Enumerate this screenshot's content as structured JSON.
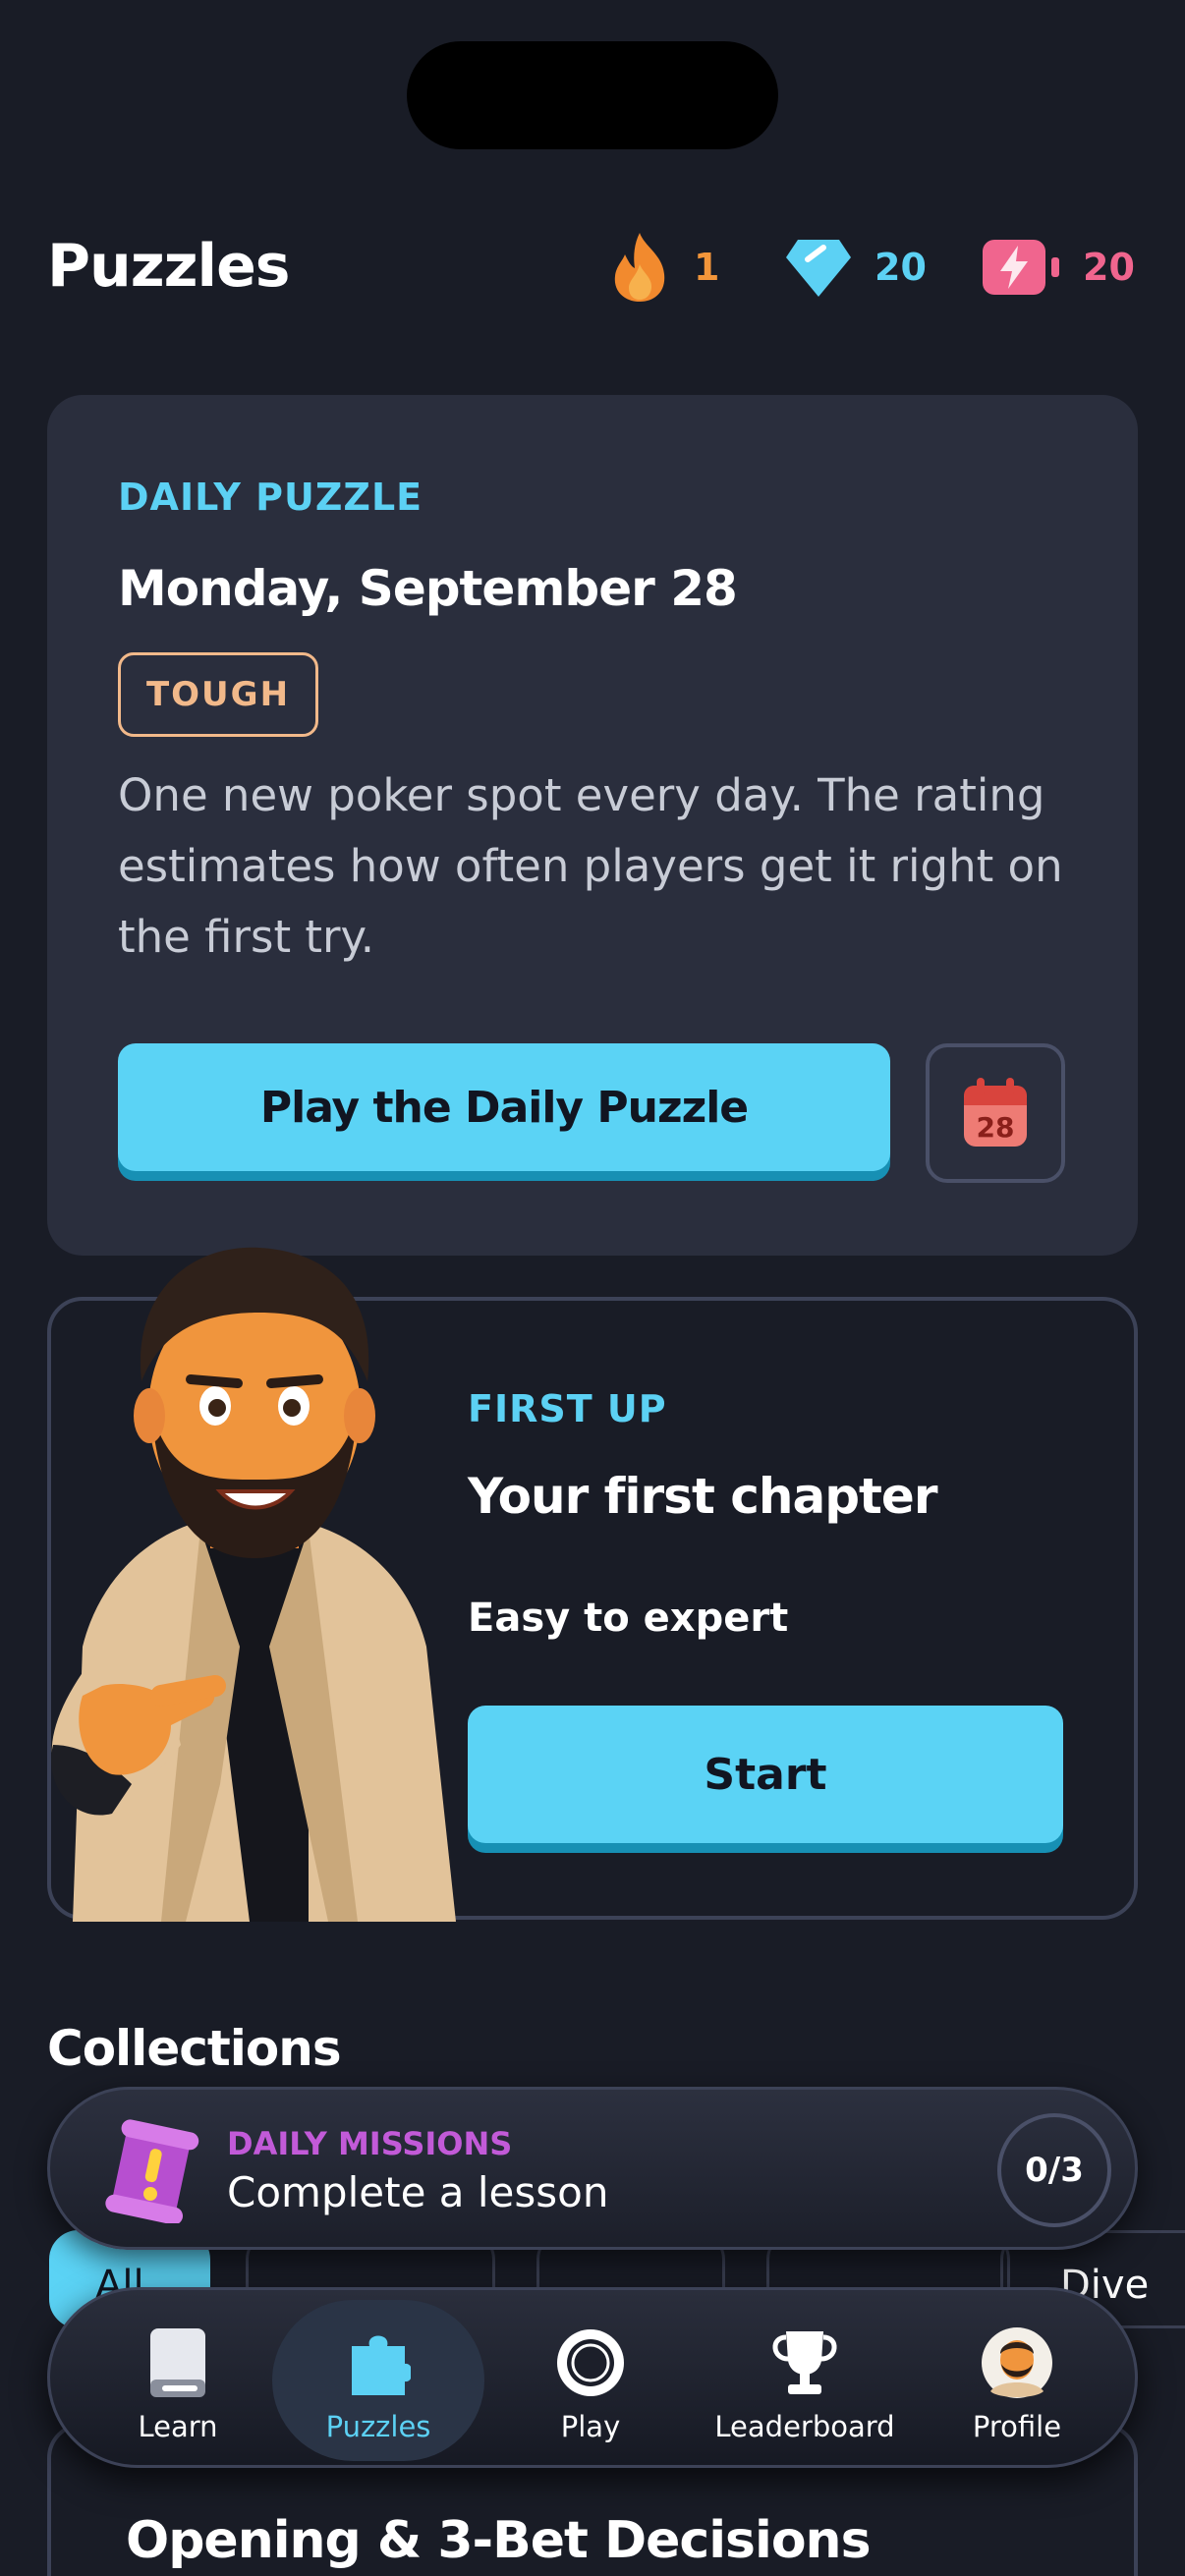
{
  "header": {
    "title": "Puzzles",
    "stats": {
      "streak": "1",
      "gems": "20",
      "energy": "20"
    }
  },
  "daily": {
    "kicker": "DAILY PUZZLE",
    "date": "Monday, September 28",
    "difficulty": "TOUGH",
    "description": "One new poker spot every day. The rating estimates how often players get it right on the first try.",
    "play_label": "Play the Daily Puzzle",
    "calendar_day": "28"
  },
  "first_up": {
    "kicker": "FIRST UP",
    "title": "Your first chapter",
    "subtitle": "Easy to expert",
    "start_label": "Start"
  },
  "collections": {
    "title": "Collections",
    "chips": [
      {
        "label": "All",
        "active": true
      },
      {
        "label": "",
        "active": false
      },
      {
        "label": "",
        "active": false
      },
      {
        "label": "",
        "active": false
      },
      {
        "label": "Dive",
        "active": false
      }
    ],
    "card_title": "Opening & 3-Bet Decisions"
  },
  "mission": {
    "kicker": "DAILY MISSIONS",
    "text": "Complete a lesson",
    "progress": "0/3"
  },
  "tabbar": {
    "tabs": [
      {
        "label": "Learn",
        "icon": "book-icon"
      },
      {
        "label": "Puzzles",
        "icon": "puzzle-icon",
        "active": true
      },
      {
        "label": "Play",
        "icon": "poker-chip-icon"
      },
      {
        "label": "Leaderboard",
        "icon": "trophy-icon"
      },
      {
        "label": "Profile",
        "icon": "avatar"
      }
    ]
  },
  "colors": {
    "background": "#191c26",
    "card": "#2a2e3d",
    "accent": "#5bd3f5",
    "fire": "#f2953a",
    "energy": "#f0658e",
    "mission": "#c25ad8"
  }
}
